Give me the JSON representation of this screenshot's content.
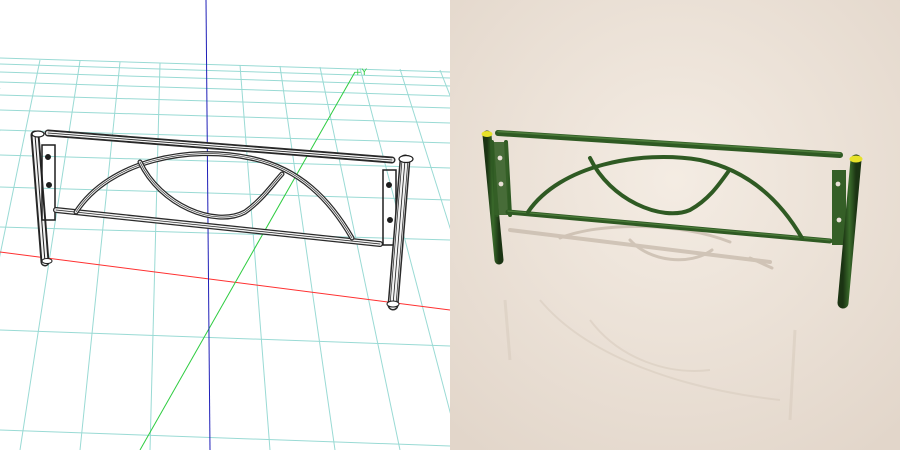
{
  "viewport": {
    "axis_label": "+Y"
  },
  "colors": {
    "grid": "#8fd6d0",
    "x_axis": "#ff3030",
    "y_axis": "#2ecc40",
    "z_axis": "#1f1fb8",
    "wire": "#1e1e1e",
    "fence_green": "#2f5a23",
    "fence_green_dark": "#1f3d16",
    "cap_yellow": "#e7e22a",
    "render_bg_light": "#f1e8de",
    "render_bg_dark": "#e5d9cd"
  },
  "panels": {
    "left": "wireframe",
    "right": "render"
  }
}
